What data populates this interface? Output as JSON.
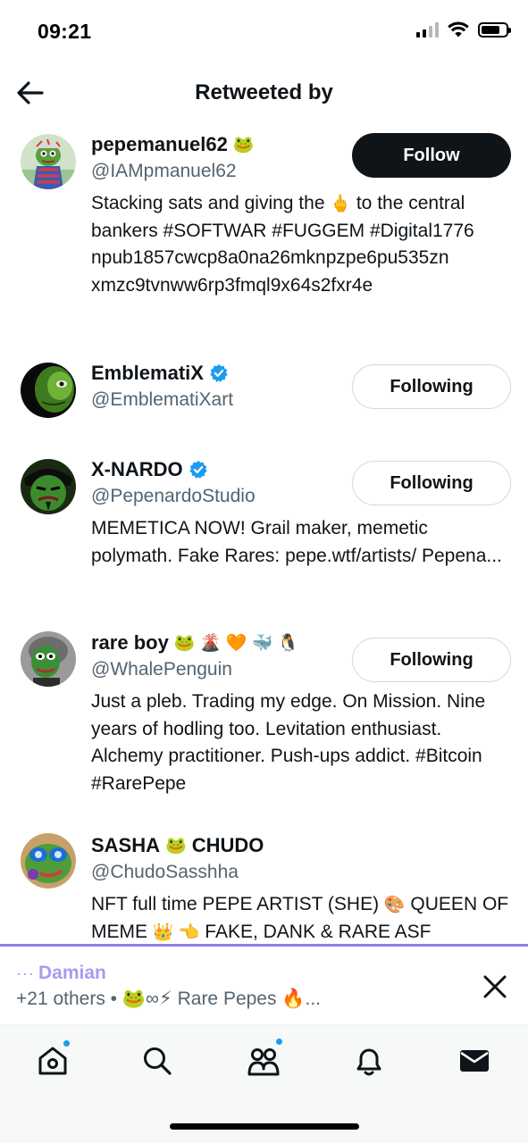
{
  "status_bar": {
    "time": "09:21"
  },
  "header": {
    "title": "Retweeted by",
    "back_icon": "arrow-left-icon"
  },
  "users": [
    {
      "display_name": "pepemanuel62",
      "name_emojis": "🐸",
      "verified": false,
      "handle": "@IAMpmanuel62",
      "button": "Follow",
      "bio_parts": [
        "Stacking sats and giving the ",
        "🖕",
        " to the central bankers #SOFTWAR #FUGGEM #Digital1776 npub1857cwcp8a0na26mknpzpe6pu535zn xmzc9tvnww6rp3fmql9x64s2fxr4e"
      ]
    },
    {
      "display_name": "EmblematiX",
      "name_emojis": "",
      "verified": true,
      "handle": "@EmblematiXart",
      "button": "Following",
      "bio_parts": []
    },
    {
      "display_name": "X-NARDO",
      "name_emojis": "",
      "verified": true,
      "handle": "@PepenardoStudio",
      "button": "Following",
      "bio_parts": [
        "MEMETICA NOW! Grail maker, memetic polymath. Fake Rares: pepe.wtf/artists/ Pepena..."
      ]
    },
    {
      "display_name": "rare boy",
      "name_emojis": "🐸 🌋 🧡 🐳 🐧",
      "verified": false,
      "handle": "@WhalePenguin",
      "button": "Following",
      "bio_parts": [
        "Just a pleb. Trading my edge. On Mission. Nine years of hodling too. Levitation enthusiast. Alchemy practitioner. Push-ups addict. #Bitcoin #RarePepe"
      ]
    },
    {
      "display_name_a": "SASHA",
      "name_emojis": "🐸",
      "display_name_b": "CHUDO",
      "verified": false,
      "handle": "@ChudoSasshha",
      "button": null,
      "bio_parts": [
        "NFT full time PEPE ARTIST (SHE) ",
        "🎨",
        " QUEEN OF MEME ",
        "👑 👈",
        " FAKE, DANK & RARE ASF"
      ]
    }
  ],
  "activity": {
    "dots": "···",
    "name": "Damian",
    "others": "+21 others",
    "separator": "•",
    "badge_emojis": "🐸∞⚡",
    "community": "Rare Pepes",
    "trail_emoji": "🔥",
    "ellipsis": "..."
  },
  "tabs": [
    "home-icon",
    "search-icon",
    "communities-icon",
    "notifications-icon",
    "messages-icon"
  ],
  "colors": {
    "accent": "#1d9bf0",
    "activity_line": "#8f7ce8",
    "activity_name": "#a99af0",
    "secondary_text": "#536471",
    "primary_text": "#0f1419"
  }
}
